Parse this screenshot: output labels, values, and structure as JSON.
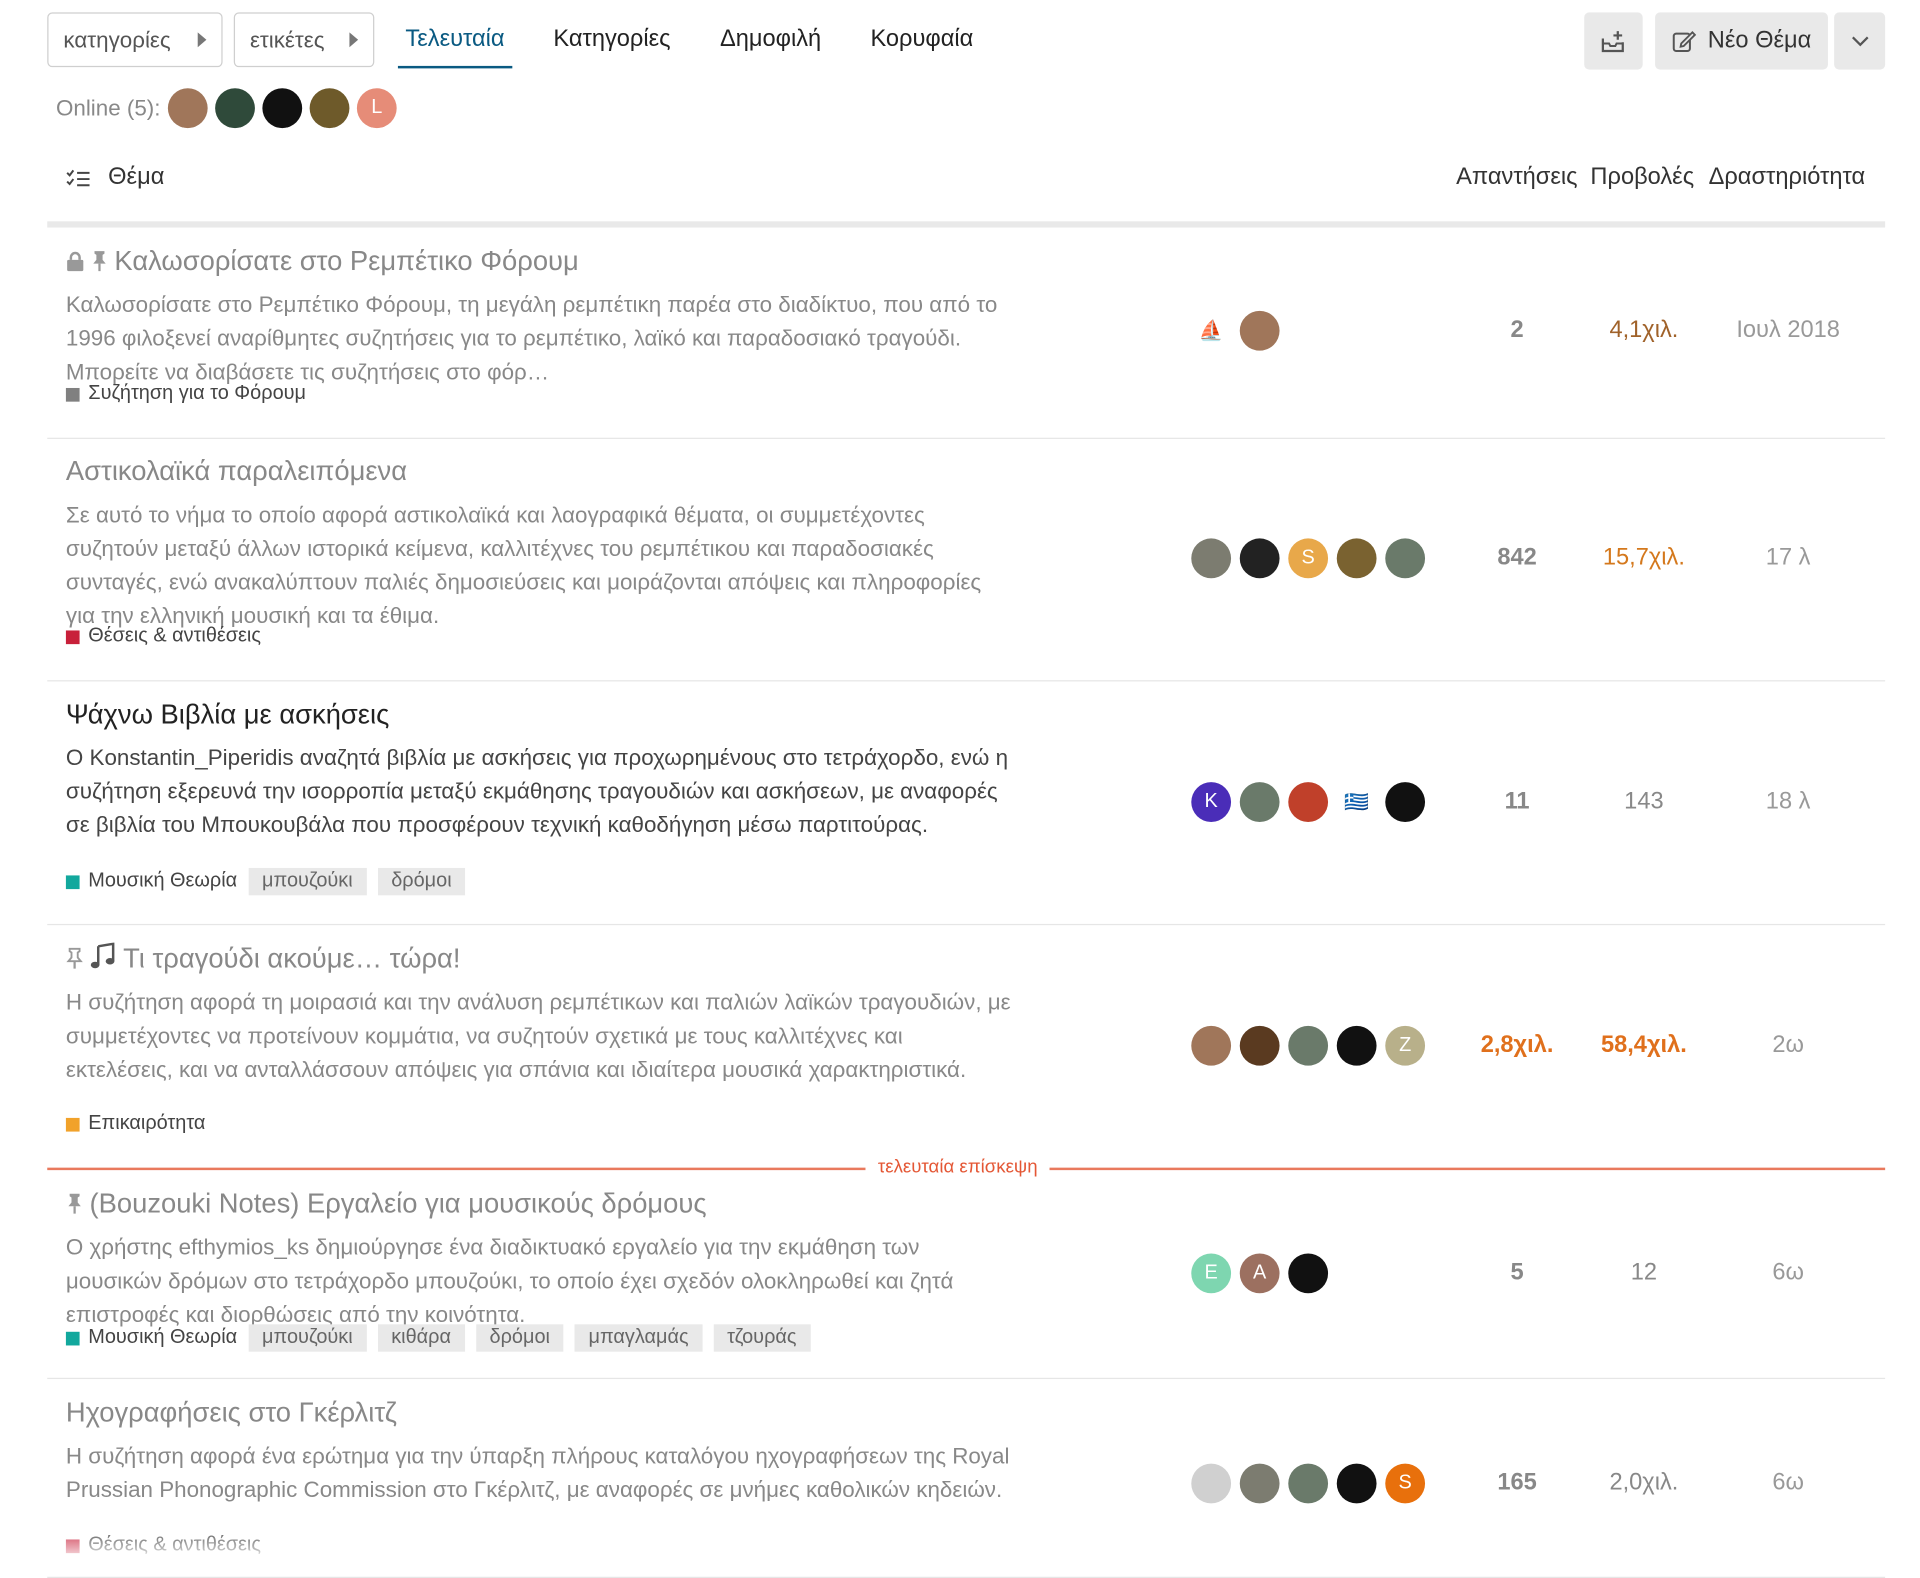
{
  "nav": {
    "categories_dropdown": "κατηγορίες",
    "tags_dropdown": "ετικέτες",
    "tabs": [
      "Τελευταία",
      "Κατηγορίες",
      "Δημοφιλή",
      "Κορυφαία"
    ],
    "new_topic": "Νέο Θέμα"
  },
  "online": {
    "label": "Online (5):",
    "avatars": [
      {
        "letter": "",
        "color": "#a0765a"
      },
      {
        "letter": "",
        "color": "#2f4a3a"
      },
      {
        "letter": "",
        "color": "#111111"
      },
      {
        "letter": "",
        "color": "#6e5a2a"
      },
      {
        "letter": "L",
        "color": "#e68c78"
      }
    ]
  },
  "header": {
    "topic": "Θέμα",
    "replies": "Απαντήσεις",
    "views": "Προβολές",
    "activity": "Δραστηριότητα"
  },
  "accent": {
    "brand": "#0a5a82",
    "last_visit": "#e45735",
    "hot_views": "#e07b1c"
  },
  "topics": [
    {
      "title": "Καλωσορίσατε στο Ρεμπέτικο Φόρουμ",
      "icons": [
        "lock-icon",
        "pin-icon"
      ],
      "excerpt": "Καλωσορίσατε στο Ρεμπέτικο Φόρουμ, τη μεγάλη ρεμπέτικη παρέα στο διαδίκτυο, που από το 1996 φιλοξενεί αναρίθμητες συζητήσεις για το ρεμπέτικο, λαϊκό και παραδοσιακό τραγούδι. Μπορείτε να διαβάσετε τις συζητήσεις στο φόρ…",
      "category": "Συζήτηση για το Φόρουμ",
      "category_color": "#808080",
      "tags": [],
      "posters": [
        {
          "letter": "⛵",
          "color": "#ffffff"
        },
        {
          "letter": "",
          "color": "#a0765a"
        }
      ],
      "replies": "2",
      "views": "4,1χιλ.",
      "activity": "Ιουλ 2018",
      "views_color": "#a0622a"
    },
    {
      "title": "Αστικολαϊκά παραλειπόμενα",
      "icons": [],
      "excerpt": "Σε αυτό το νήμα το οποίο αφορά αστικολαϊκά και λαογραφικά θέματα, οι συμμετέχοντες συζητούν μεταξύ άλλων ιστορικά κείμενα, καλλιτέχνες του ρεμπέτικου και παραδοσιακές συνταγές, ενώ ανακαλύπτουν παλιές δημοσιεύσεις και μοιράζονται απόψεις και πληροφορίες για την ελληνική μουσική και τα έθιμα.",
      "category": "Θέσεις & αντιθέσεις",
      "category_color": "#c8203a",
      "tags": [],
      "posters": [
        {
          "letter": "",
          "color": "#7c7c70"
        },
        {
          "letter": "",
          "color": "#222222"
        },
        {
          "letter": "S",
          "color": "#e8a84a"
        },
        {
          "letter": "",
          "color": "#7a6230"
        },
        {
          "letter": "",
          "color": "#6a7a6a"
        }
      ],
      "replies": "842",
      "views": "15,7χιλ.",
      "activity": "17 λ",
      "views_color": "#d4781c"
    },
    {
      "title": "Ψάχνω Βιβλία με ασκήσεις",
      "icons": [],
      "excerpt": "Ο Konstantin_Piperidis αναζητά βιβλία με ασκήσεις για προχωρημένους στο τετράχορδο, ενώ η συζήτηση εξερευνά την ισορροπία μεταξύ εκμάθησης τραγουδιών και ασκήσεων, με αναφορές σε βιβλία του Μπουκουβάλα που προσφέρουν τεχνική καθοδήγηση μέσω παρτιτούρας.",
      "category": "Μουσική Θεωρία",
      "category_color": "#12a89d",
      "tags": [
        "μπουζούκι",
        "δρόμοι"
      ],
      "posters": [
        {
          "letter": "K",
          "color": "#4a2db8"
        },
        {
          "letter": "",
          "color": "#6a7a6a"
        },
        {
          "letter": "",
          "color": "#c0402a"
        },
        {
          "letter": "🇬🇷",
          "color": "#ffffff"
        },
        {
          "letter": "",
          "color": "#111111"
        }
      ],
      "replies": "11",
      "views": "143",
      "activity": "18 λ",
      "views_color": "#888888"
    },
    {
      "title": "Τι τραγούδι ακούμε… τώρα!",
      "icons": [
        "pin-outline-icon",
        "music-note-icon"
      ],
      "excerpt": "Η συζήτηση αφορά τη μοιρασιά και την ανάλυση ρεμπέτικων και παλιών λαϊκών τραγουδιών, με συμμετέχοντες να προτείνουν κομμάτια, να συζητούν σχετικά με τους καλλιτέχνες και εκτελέσεις, και να ανταλλάσσουν απόψεις για σπάνια και ιδιαίτερα μουσικά χαρακτηριστικά.",
      "category": "Επικαιρότητα",
      "category_color": "#f1a22a",
      "tags": [],
      "posters": [
        {
          "letter": "",
          "color": "#a0765a"
        },
        {
          "letter": "",
          "color": "#5a3a20"
        },
        {
          "letter": "",
          "color": "#6a7a6a"
        },
        {
          "letter": "",
          "color": "#111111"
        },
        {
          "letter": "Z",
          "color": "#b8b08a"
        }
      ],
      "replies": "2,8χιλ.",
      "views": "58,4χιλ.",
      "activity": "2ω",
      "views_color": "#e0701c"
    },
    {
      "title": "(Bouzouki Notes) Εργαλείο για μουσικούς δρόμους",
      "icons": [
        "pin-icon"
      ],
      "excerpt": "Ο χρήστης efthymios_ks δημιούργησε ένα διαδικτυακό εργαλείο για την εκμάθηση των μουσικών δρόμων στο τετράχορδο μπουζούκι, το οποίο έχει σχεδόν ολοκληρωθεί και ζητά επιστροφές και διορθώσεις από την κοινότητα.",
      "category": "Μουσική Θεωρία",
      "category_color": "#12a89d",
      "tags": [
        "μπουζούκι",
        "κιθάρα",
        "δρόμοι",
        "μπαγλαμάς",
        "τζουράς"
      ],
      "posters": [
        {
          "letter": "E",
          "color": "#7ed6b0"
        },
        {
          "letter": "A",
          "color": "#9c7060"
        },
        {
          "letter": "",
          "color": "#111111"
        }
      ],
      "replies": "5",
      "views": "12",
      "activity": "6ω",
      "views_color": "#888888"
    },
    {
      "title": "Ηχογραφήσεις στο Γκέρλιτζ",
      "icons": [],
      "excerpt": "Η συζήτηση αφορά ένα ερώτημα για την ύπαρξη πλήρους καταλόγου ηχογραφήσεων της Royal Prussian Phonographic Commission στο Γκέρλιτζ, με αναφορές σε μνήμες καθολικών κηδειών.",
      "category": "Θέσεις & αντιθέσεις",
      "category_color": "#c8203a",
      "tags": [],
      "posters": [
        {
          "letter": "",
          "color": "#d0d0d0"
        },
        {
          "letter": "",
          "color": "#7c7c70"
        },
        {
          "letter": "",
          "color": "#6a7a6a"
        },
        {
          "letter": "",
          "color": "#111111"
        },
        {
          "letter": "S",
          "color": "#e8700c"
        }
      ],
      "replies": "165",
      "views": "2,0χιλ.",
      "activity": "6ω",
      "views_color": "#888888"
    }
  ],
  "last_visit_label": "τελευταία επίσκεψη"
}
